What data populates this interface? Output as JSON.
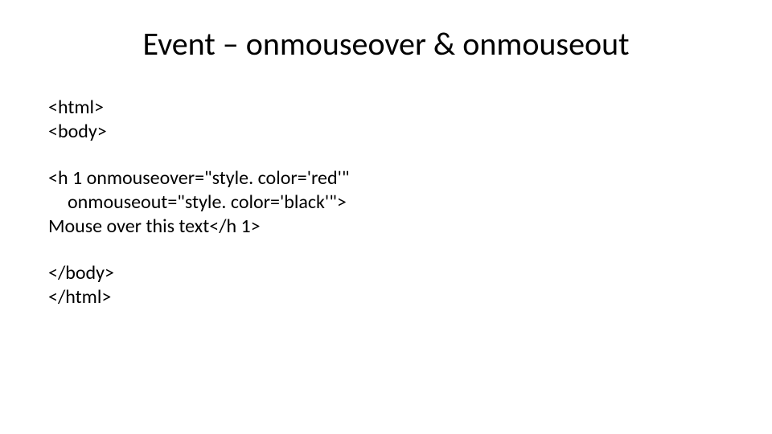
{
  "title": "Event – onmouseover & onmouseout",
  "code": {
    "block1": {
      "line1": "<html>",
      "line2": "<body>"
    },
    "block2": {
      "line1": "<h 1 onmouseover=\"style. color='red'\"",
      "line2": "onmouseout=\"style. color='black'\">",
      "line3": "Mouse over this text</h 1>"
    },
    "block3": {
      "line1": "</body>",
      "line2": "</html>"
    }
  }
}
